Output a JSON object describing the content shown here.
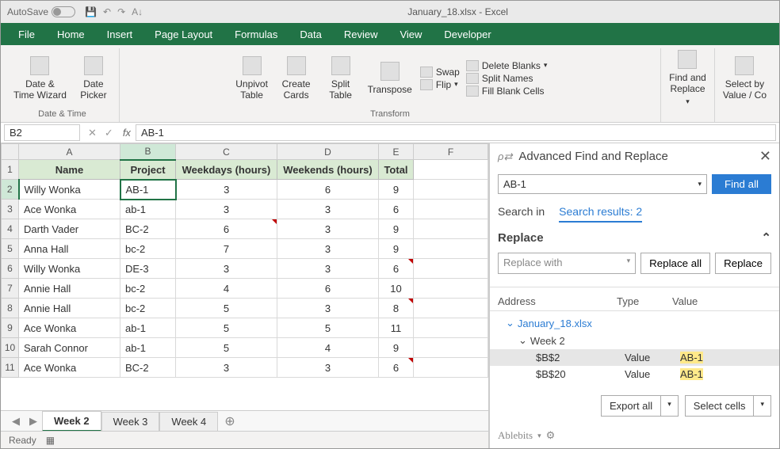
{
  "titlebar": {
    "autosave": "AutoSave",
    "filename": "January_18.xlsx - Excel"
  },
  "menubar": [
    "File",
    "Home",
    "Insert",
    "Page Layout",
    "Formulas",
    "Data",
    "Review",
    "View",
    "Developer"
  ],
  "ribbon": {
    "g1": {
      "label": "Date & Time",
      "btn1": "Date &\nTime Wizard",
      "btn2": "Date\nPicker"
    },
    "g2": {
      "label": "Transform",
      "b1": "Unpivot\nTable",
      "b2": "Create\nCards",
      "b3": "Split\nTable",
      "b4": "Transpose",
      "s1": "Swap",
      "s2": "Flip",
      "s3": "Delete Blanks",
      "s4": "Split Names",
      "s5": "Fill Blank Cells"
    },
    "g3": {
      "btn": "Find and\nReplace"
    },
    "g4": {
      "btn": "Select by\nValue / Co"
    }
  },
  "formula": {
    "namebox": "B2",
    "value": "AB-1"
  },
  "headers": [
    "Name",
    "Project",
    "Weekdays (hours)",
    "Weekends (hours)",
    "Total"
  ],
  "rows": [
    {
      "n": "2",
      "name": "Willy Wonka",
      "proj": "AB-1",
      "wd": "3",
      "we": "6",
      "t": "9"
    },
    {
      "n": "3",
      "name": "Ace Wonka",
      "proj": "ab-1",
      "wd": "3",
      "we": "3",
      "t": "6"
    },
    {
      "n": "4",
      "name": "Darth Vader",
      "proj": "BC-2",
      "wd": "6",
      "we": "3",
      "t": "9"
    },
    {
      "n": "5",
      "name": "Anna Hall",
      "proj": "bc-2",
      "wd": "7",
      "we": "3",
      "t": "9"
    },
    {
      "n": "6",
      "name": "Willy Wonka",
      "proj": "DE-3",
      "wd": "3",
      "we": "3",
      "t": "6"
    },
    {
      "n": "7",
      "name": "Annie Hall",
      "proj": "bc-2",
      "wd": "4",
      "we": "6",
      "t": "10"
    },
    {
      "n": "8",
      "name": "Annie Hall",
      "proj": "bc-2",
      "wd": "5",
      "we": "3",
      "t": "8"
    },
    {
      "n": "9",
      "name": "Ace Wonka",
      "proj": "ab-1",
      "wd": "5",
      "we": "5",
      "t": "11"
    },
    {
      "n": "10",
      "name": "Sarah Connor",
      "proj": "ab-1",
      "wd": "5",
      "we": "4",
      "t": "9"
    },
    {
      "n": "11",
      "name": "Ace Wonka",
      "proj": "BC-2",
      "wd": "3",
      "we": "3",
      "t": "6"
    }
  ],
  "sheets": {
    "active": "Week 2",
    "s2": "Week 3",
    "s3": "Week 4"
  },
  "status": "Ready",
  "panel": {
    "title": "Advanced Find and Replace",
    "input": "AB-1",
    "findall": "Find all",
    "tab1": "Search in",
    "tab2": "Search results: 2",
    "replace": "Replace",
    "replaceWithPh": "Replace with",
    "replaceAll": "Replace all",
    "replaceBtn": "Replace",
    "resH1": "Address",
    "resH2": "Type",
    "resH3": "Value",
    "wb": "January_18.xlsx",
    "ws": "Week 2",
    "r1_addr": "$B$2",
    "r1_type": "Value",
    "r1_val": "AB-1",
    "r2_addr": "$B$20",
    "r2_type": "Value",
    "r2_val": "AB-1",
    "export": "Export all",
    "select": "Select cells",
    "brand": "Ablebits"
  }
}
